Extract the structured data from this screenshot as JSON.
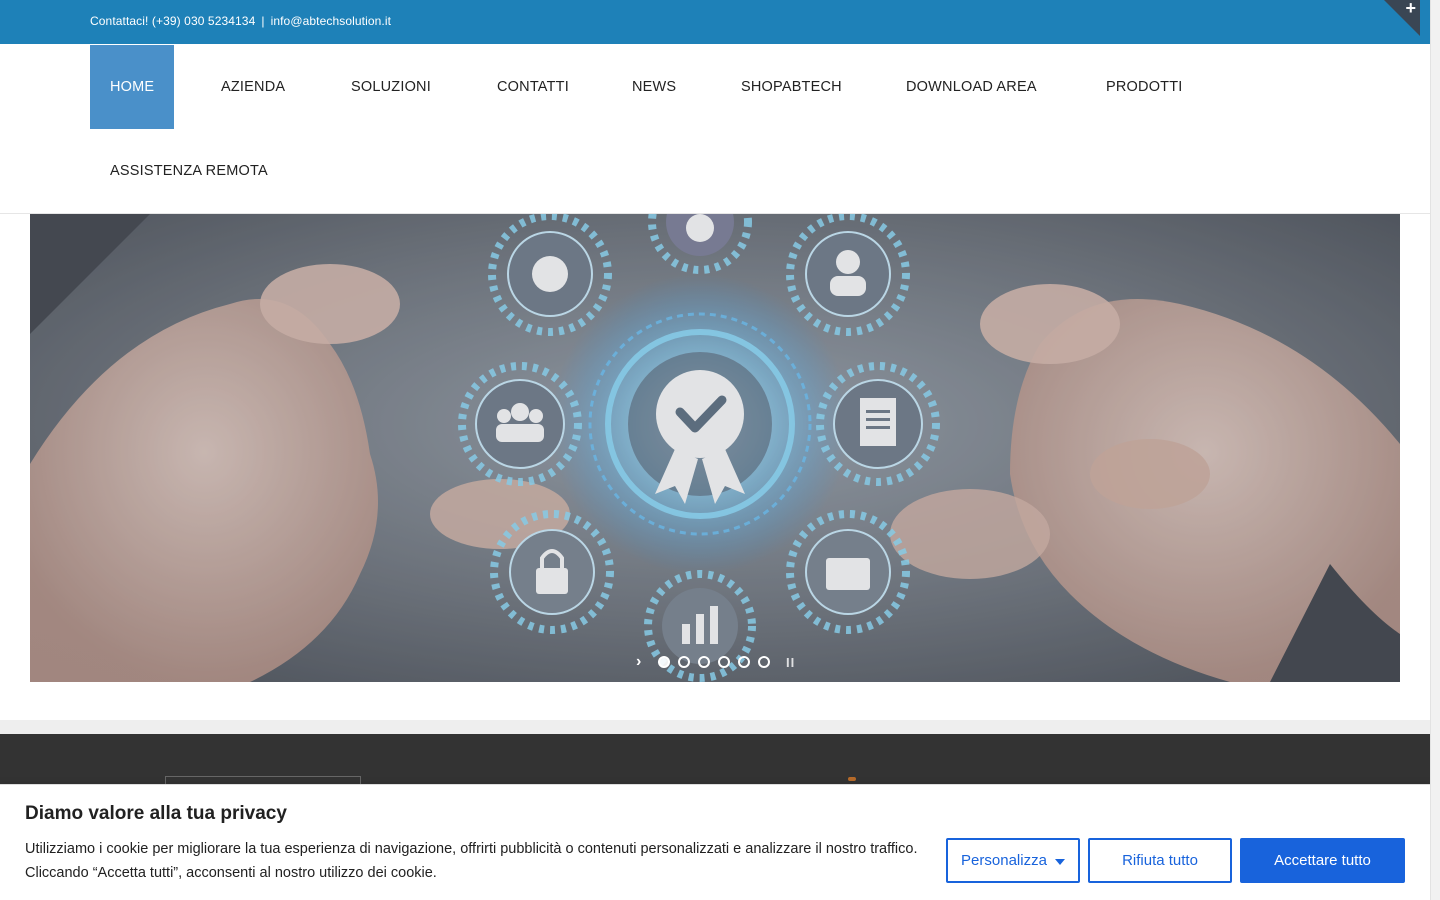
{
  "topbar": {
    "contact_text": "Contattaci! (+39) 030 5234134",
    "separator": "|",
    "email": "info@abtechsolution.it",
    "toggle_icon": "plus-icon",
    "toggle_symbol": "+"
  },
  "nav": {
    "items": [
      {
        "label": "HOME",
        "active": true
      },
      {
        "label": "AZIENDA"
      },
      {
        "label": "SOLUZIONI"
      },
      {
        "label": "CONTATTI"
      },
      {
        "label": "NEWS"
      },
      {
        "label": "SHOPABTECH"
      },
      {
        "label": "DOWNLOAD AREA"
      },
      {
        "label": "PRODOTTI"
      },
      {
        "label": "ASSISTENZA REMOTA"
      }
    ]
  },
  "hero": {
    "slide_count": 6,
    "active_slide": 1,
    "next_symbol": "›",
    "pause_symbol": "II",
    "icons": [
      "badge-check-icon",
      "globe-icon",
      "award-icon",
      "user-icon",
      "team-icon",
      "document-icon",
      "lock-icon",
      "folder-icon",
      "bar-chart-icon"
    ]
  },
  "cookie": {
    "title": "Diamo valore alla tua privacy",
    "text": "Utilizziamo i cookie per migliorare la tua esperienza di navigazione, offrirti pubblicità o contenuti personalizzati e analizzare il nostro traffico. Cliccando “Accetta tutti”, acconsenti al nostro utilizzo dei cookie.",
    "btn_customize": "Personalizza",
    "btn_reject": "Rifiuta tutto",
    "btn_accept": "Accettare tutto"
  },
  "colors": {
    "topbar": "#1e81b8",
    "nav_active": "#4a90c9",
    "cookie_primary": "#1863dc",
    "footer": "#333333"
  }
}
